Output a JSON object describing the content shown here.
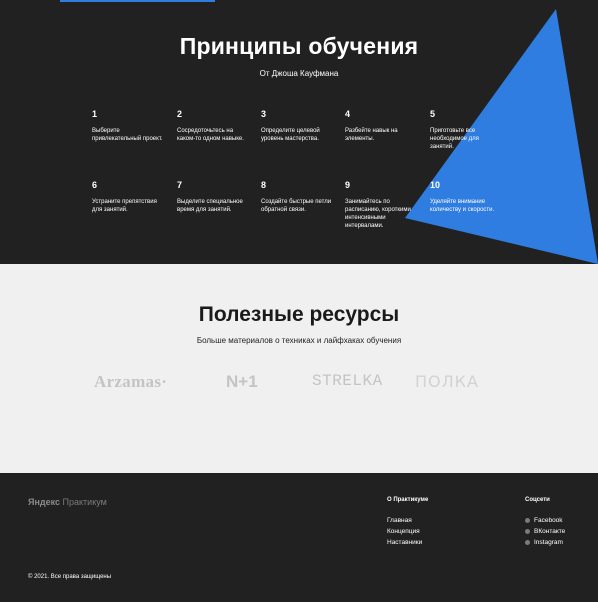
{
  "principles": {
    "title": "Принципы обучения",
    "subtitle": "От Джоша Кауфмана",
    "steps": [
      {
        "num": "1",
        "text": "Выберите привлекательный проект."
      },
      {
        "num": "2",
        "text": "Сосредоточьтесь на каком-то одном навыке."
      },
      {
        "num": "3",
        "text": "Определите целевой уровень мастерства."
      },
      {
        "num": "4",
        "text": "Разбейте навык на элементы."
      },
      {
        "num": "5",
        "text": "Приготовьте все необходимое для занятий."
      },
      {
        "num": "6",
        "text": "Устраните препятствия для занятий."
      },
      {
        "num": "7",
        "text": "Выделите специальное время для занятий."
      },
      {
        "num": "8",
        "text": "Создайте быстрые петли обратной связи."
      },
      {
        "num": "9",
        "text": "Занимайтесь по расписанию, короткими интенсивными интервалами."
      },
      {
        "num": "10",
        "text": "Уделяйте внимание количеству и скорости."
      }
    ],
    "accent_color": "#2f7de1"
  },
  "resources": {
    "title": "Полезные ресурсы",
    "subtitle": "Больше материалов о техниках и лайфхаках обучения",
    "logos": [
      "Arzamas·",
      "N+1",
      "STRELKA",
      "ПОЛКА"
    ]
  },
  "footer": {
    "brand_bold": "Яндекс",
    "brand_light": "Практикум",
    "about_title": "О Практикуме",
    "about_links": [
      "Главная",
      "Концепция",
      "Наставники"
    ],
    "social_title": "Соцсети",
    "social_links": [
      "Facebook",
      "ВКонтакте",
      "Instagram"
    ],
    "copyright": "© 2021. Все права защищены"
  }
}
